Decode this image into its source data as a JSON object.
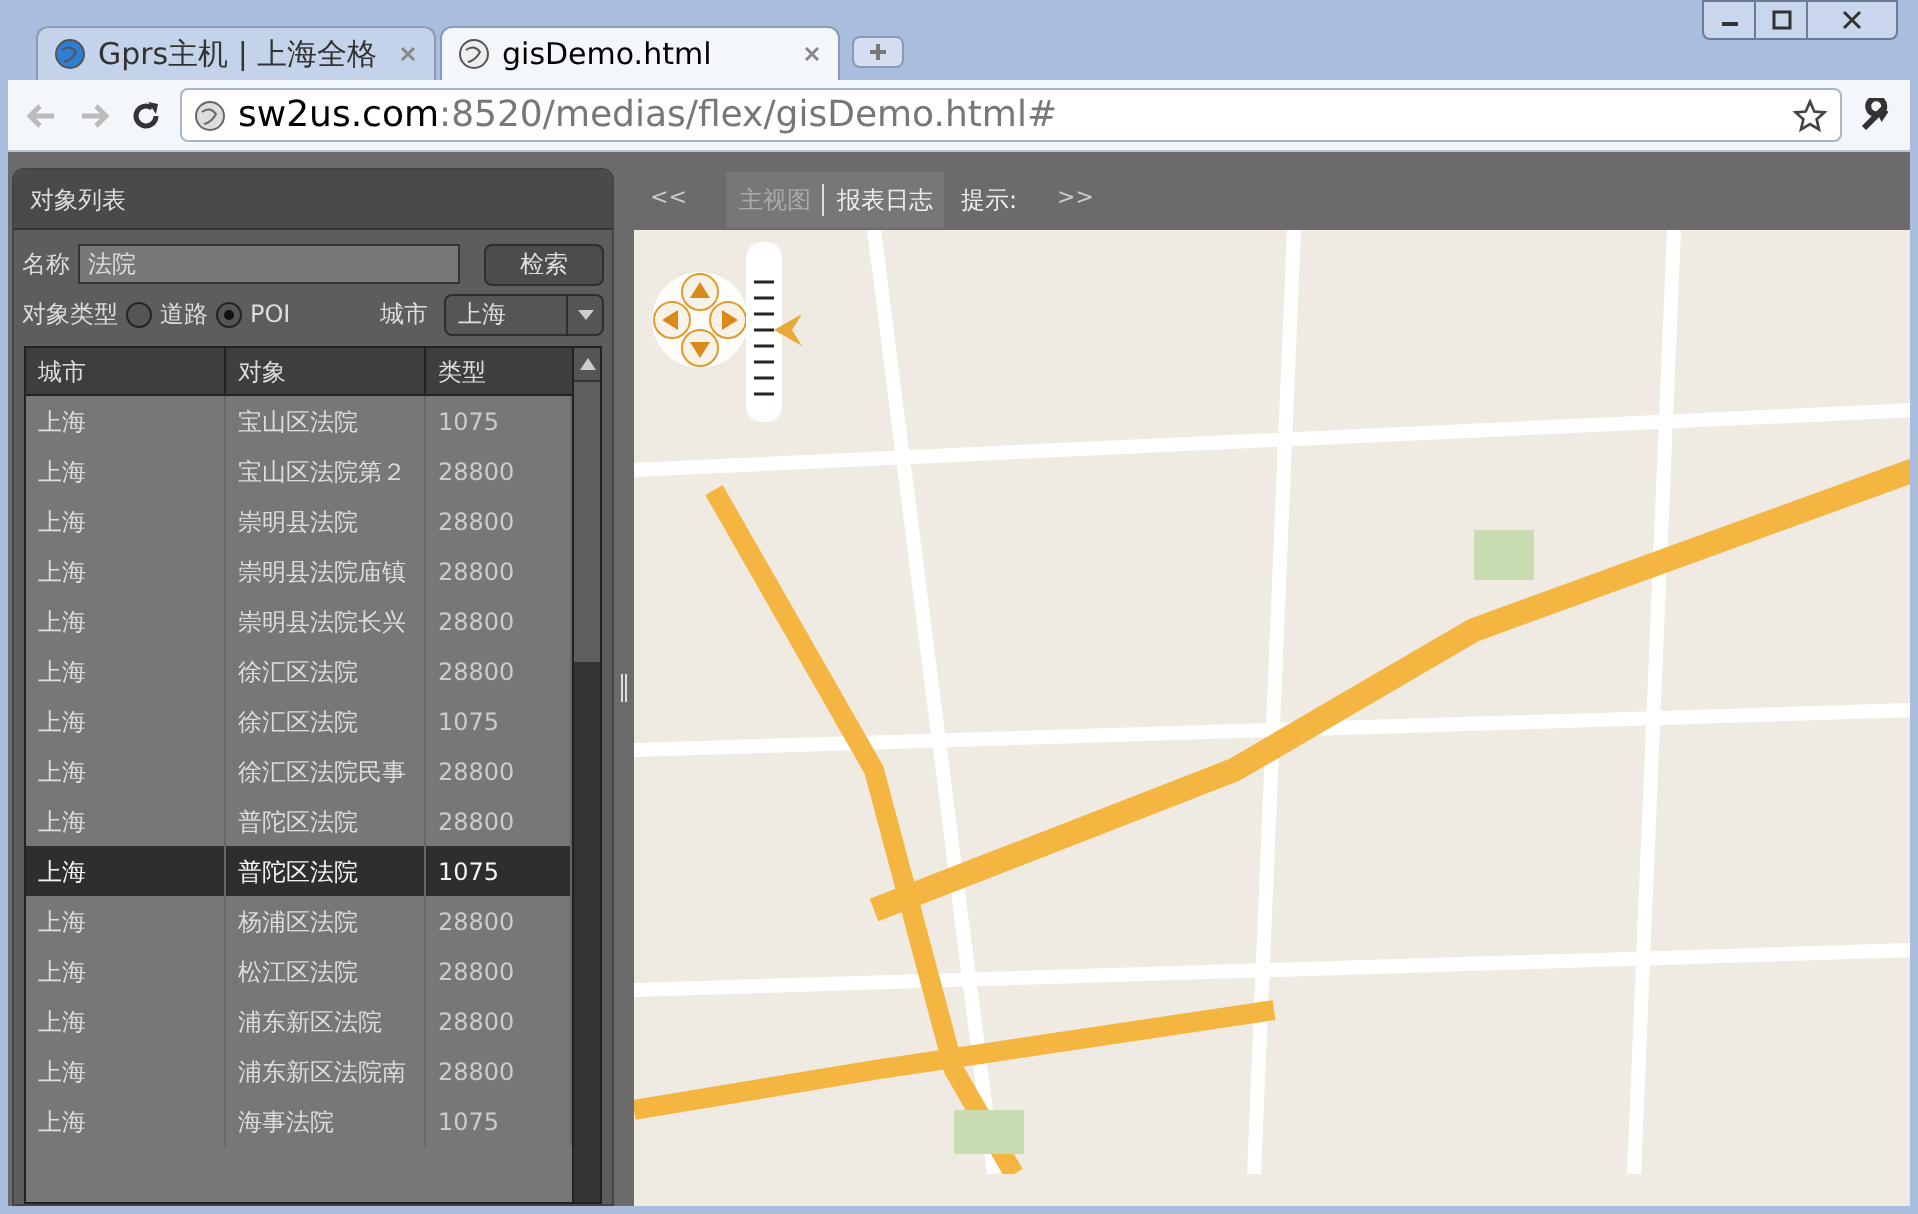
{
  "browser": {
    "tabs": [
      {
        "title": "Gprs主机 | 上海全格",
        "selected": false
      },
      {
        "title": "gisDemo.html",
        "selected": true
      }
    ],
    "url_host": "sw2us.com",
    "url_path": ":8520/medias/flex/gisDemo.html#"
  },
  "panel": {
    "title": "对象列表",
    "name_label": "名称",
    "name_value": "法院",
    "search_button": "检索",
    "type_label": "对象类型",
    "types": [
      {
        "label": "道路",
        "selected": false
      },
      {
        "label": "POI",
        "selected": true
      }
    ],
    "city_label": "城市",
    "city_value": "上海",
    "table": {
      "columns": [
        "城市",
        "对象",
        "类型"
      ],
      "rows": [
        {
          "cells": [
            "上海",
            "宝山区法院",
            "1075"
          ],
          "selected": false
        },
        {
          "cells": [
            "上海",
            "宝山区法院第２",
            "28800"
          ],
          "selected": false
        },
        {
          "cells": [
            "上海",
            "崇明县法院",
            "28800"
          ],
          "selected": false
        },
        {
          "cells": [
            "上海",
            "崇明县法院庙镇",
            "28800"
          ],
          "selected": false
        },
        {
          "cells": [
            "上海",
            "崇明县法院长兴",
            "28800"
          ],
          "selected": false
        },
        {
          "cells": [
            "上海",
            "徐汇区法院",
            "28800"
          ],
          "selected": false
        },
        {
          "cells": [
            "上海",
            "徐汇区法院",
            "1075"
          ],
          "selected": false
        },
        {
          "cells": [
            "上海",
            "徐汇区法院民事",
            "28800"
          ],
          "selected": false
        },
        {
          "cells": [
            "上海",
            "普陀区法院",
            "28800"
          ],
          "selected": false
        },
        {
          "cells": [
            "上海",
            "普陀区法院",
            "1075"
          ],
          "selected": true
        },
        {
          "cells": [
            "上海",
            "杨浦区法院",
            "28800"
          ],
          "selected": false
        },
        {
          "cells": [
            "上海",
            "松江区法院",
            "28800"
          ],
          "selected": false
        },
        {
          "cells": [
            "上海",
            "浦东新区法院",
            "28800"
          ],
          "selected": false
        },
        {
          "cells": [
            "上海",
            "浦东新区法院南",
            "28800"
          ],
          "selected": false
        },
        {
          "cells": [
            "上海",
            "海事法院",
            "1075"
          ],
          "selected": false
        }
      ]
    }
  },
  "map_bar": {
    "prev": "<<",
    "views": [
      {
        "label": "主视图",
        "selected": true
      },
      {
        "label": "报表日志",
        "selected": false
      }
    ],
    "hint_label": "提示:",
    "next": ">>"
  }
}
